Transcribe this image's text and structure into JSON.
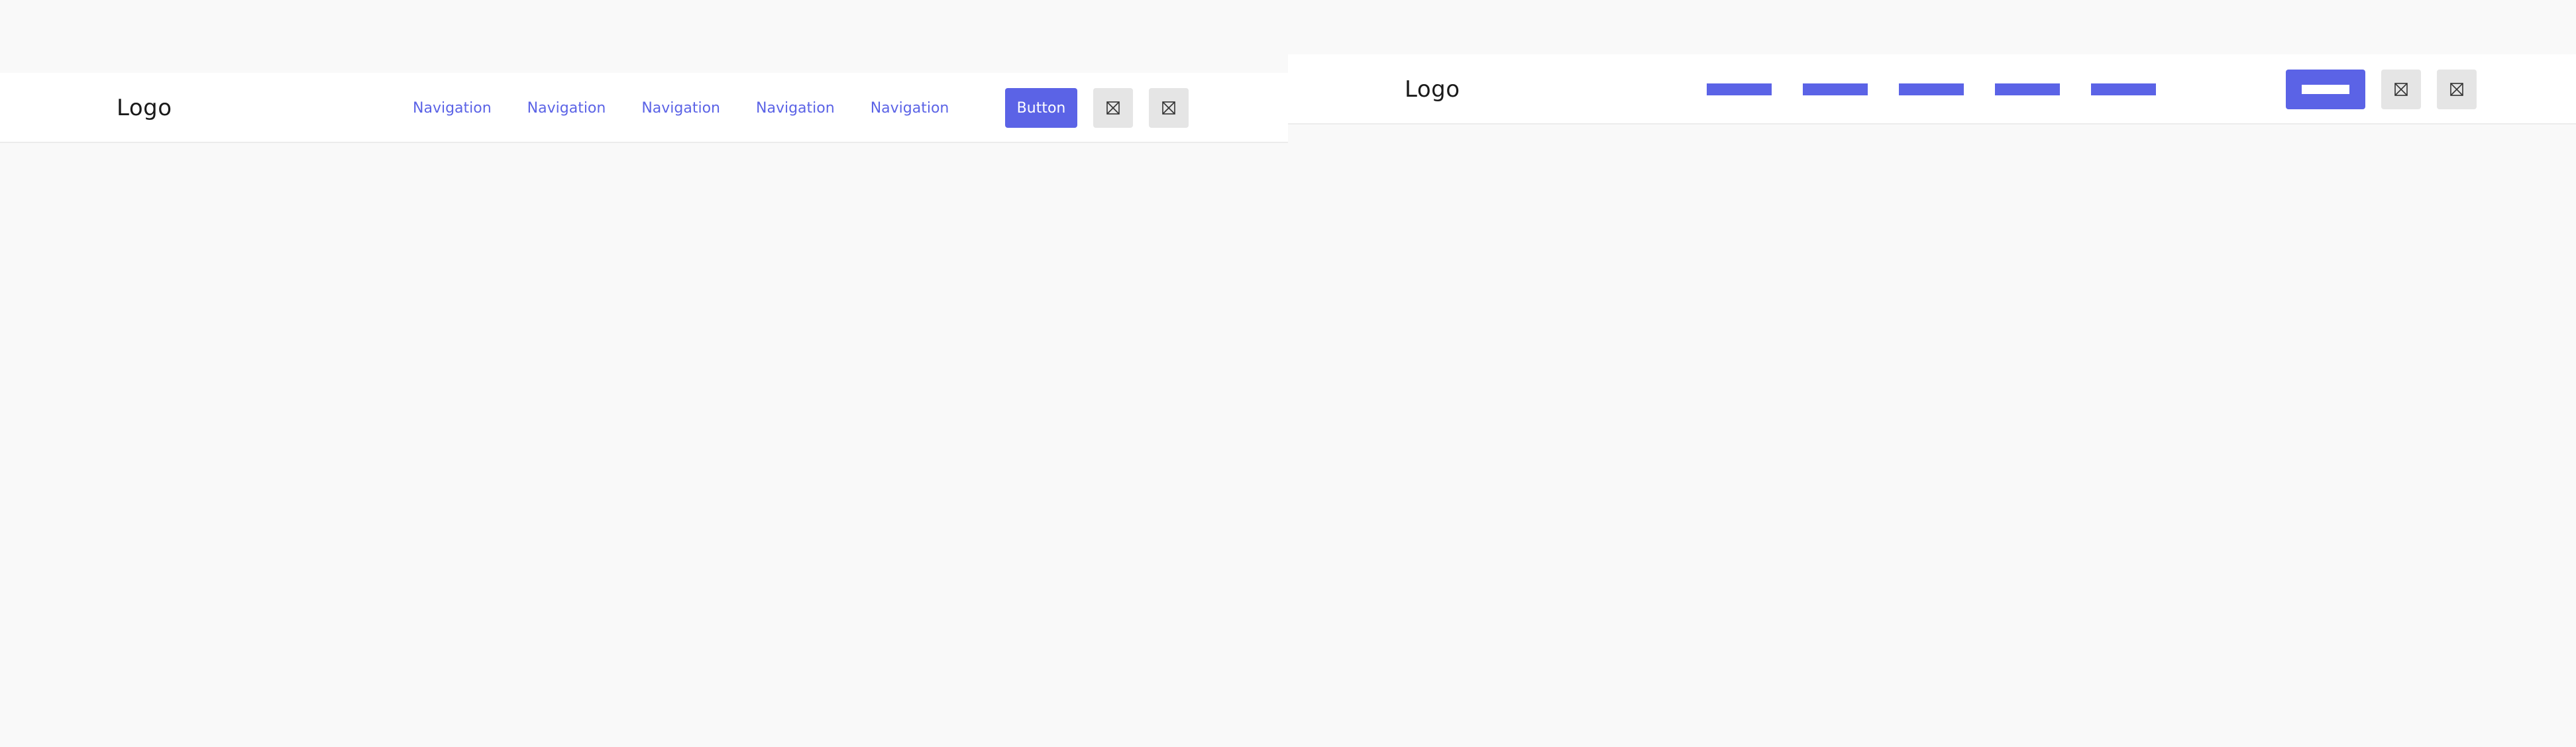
{
  "left_panel": {
    "logo": "Logo",
    "nav_items": [
      "Navigation",
      "Navigation",
      "Navigation",
      "Navigation",
      "Navigation"
    ],
    "primary_button": "Button",
    "icon_buttons": [
      "placeholder-icon",
      "placeholder-icon"
    ]
  },
  "right_panel": {
    "logo": "Logo",
    "nav_items_skeleton_count": 5,
    "primary_button_skeleton": true,
    "icon_buttons": [
      "placeholder-icon",
      "placeholder-icon"
    ]
  },
  "colors": {
    "accent": "#5b63e6",
    "background": "#f9f9f9",
    "header": "#ffffff",
    "icon_button": "#e5e5e5"
  }
}
